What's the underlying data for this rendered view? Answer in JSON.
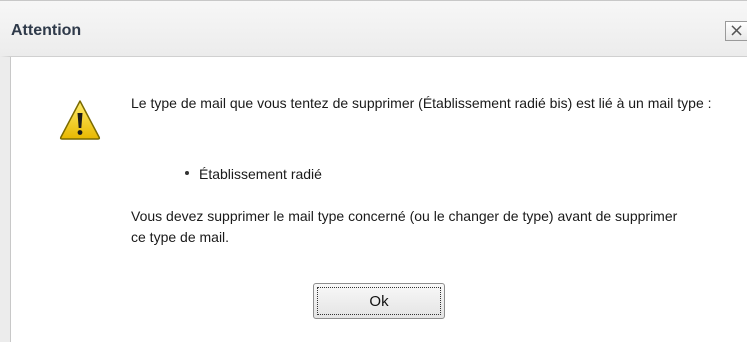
{
  "dialog": {
    "title": "Attention",
    "close_label": "×",
    "icon": "warning-icon",
    "message_intro": "Le type de mail que vous tentez de supprimer (Établissement radié bis) est lié à un mail type :",
    "linked_items": [
      "Établissement radié"
    ],
    "message_instruction": "Vous devez supprimer le mail type concerné (ou le changer de type) avant de supprimer ce type de mail.",
    "ok_label": "Ok"
  },
  "colors": {
    "title_text": "#2f3a4a",
    "warning_fill": "#f5d01c",
    "warning_outline": "#7a6a00"
  }
}
